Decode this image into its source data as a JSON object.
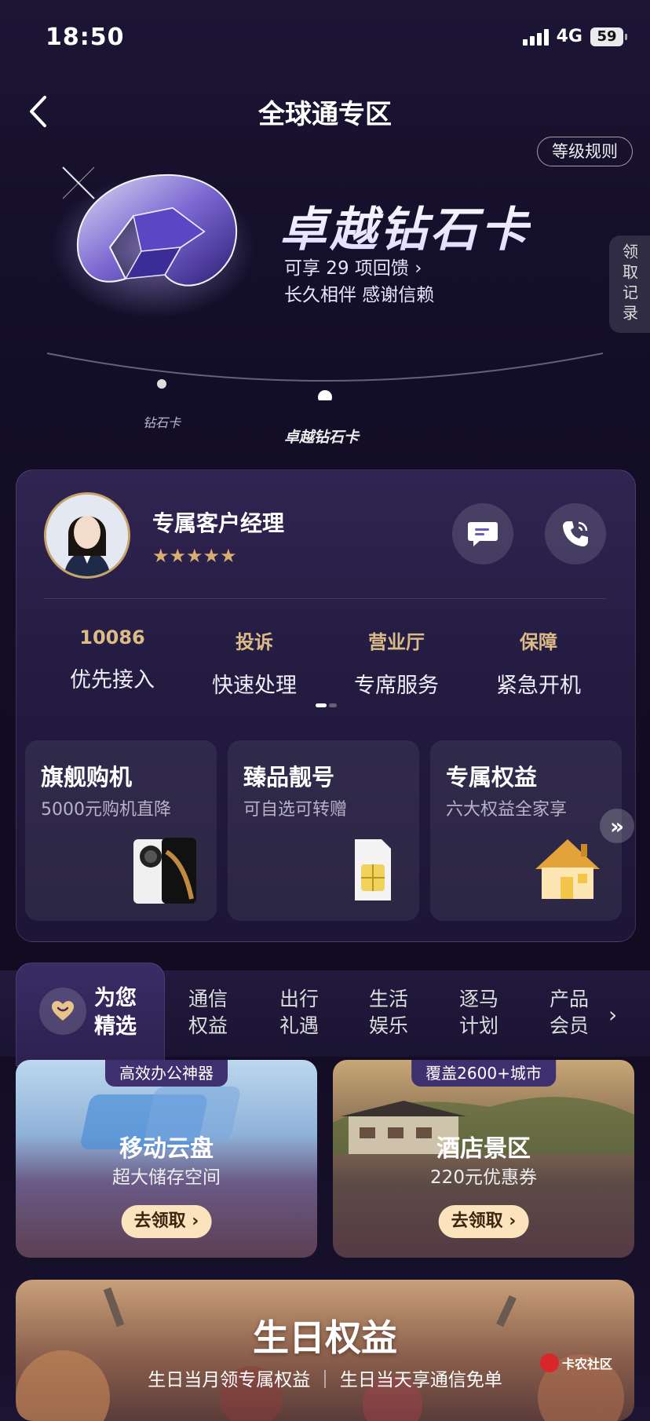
{
  "status_bar": {
    "time": "18:50",
    "network": "4G",
    "battery": "59"
  },
  "nav": {
    "title": "全球通专区",
    "rules_label": "等级规则"
  },
  "hero": {
    "card_name": "卓越钻石卡",
    "benefits_link": "可享 29 项回馈",
    "slogan": "长久相伴 感谢信赖",
    "records_tab": "领取记录",
    "levels": [
      "钻石卡",
      "卓越钻石卡"
    ]
  },
  "manager": {
    "title": "专属客户经理",
    "rating": 5,
    "stars": "★★★★★"
  },
  "services": [
    {
      "title": "10086",
      "subtitle": "优先接入"
    },
    {
      "title": "投诉",
      "subtitle": "快速处理"
    },
    {
      "title": "营业厅",
      "subtitle": "专席服务"
    },
    {
      "title": "保障",
      "subtitle": "紧急开机"
    }
  ],
  "features": [
    {
      "title": "旗舰购机",
      "subtitle": "5000元购机直降"
    },
    {
      "title": "臻品靓号",
      "subtitle": "可自选可转赠"
    },
    {
      "title": "专属权益",
      "subtitle": "六大权益全家享"
    }
  ],
  "tabs": {
    "active": "为您精选",
    "active_lines": [
      "为您",
      "精选"
    ],
    "items": [
      {
        "line1": "通信",
        "line2": "权益"
      },
      {
        "line1": "出行",
        "line2": "礼遇"
      },
      {
        "line1": "生活",
        "line2": "娱乐"
      },
      {
        "line1": "逐马",
        "line2": "计划"
      },
      {
        "line1": "产品",
        "line2": "会员"
      }
    ]
  },
  "promos": [
    {
      "badge": "高效办公神器",
      "title": "移动云盘",
      "subtitle": "超大储存空间",
      "button": "去领取"
    },
    {
      "badge": "覆盖2600+城市",
      "title": "酒店景区",
      "subtitle": "220元优惠券",
      "button": "去领取"
    }
  ],
  "birthday": {
    "title": "生日权益",
    "subtitle_left": "生日当月领专属权益",
    "subtitle_right": "生日当天享通信免单"
  },
  "watermark": "卡农社区"
}
